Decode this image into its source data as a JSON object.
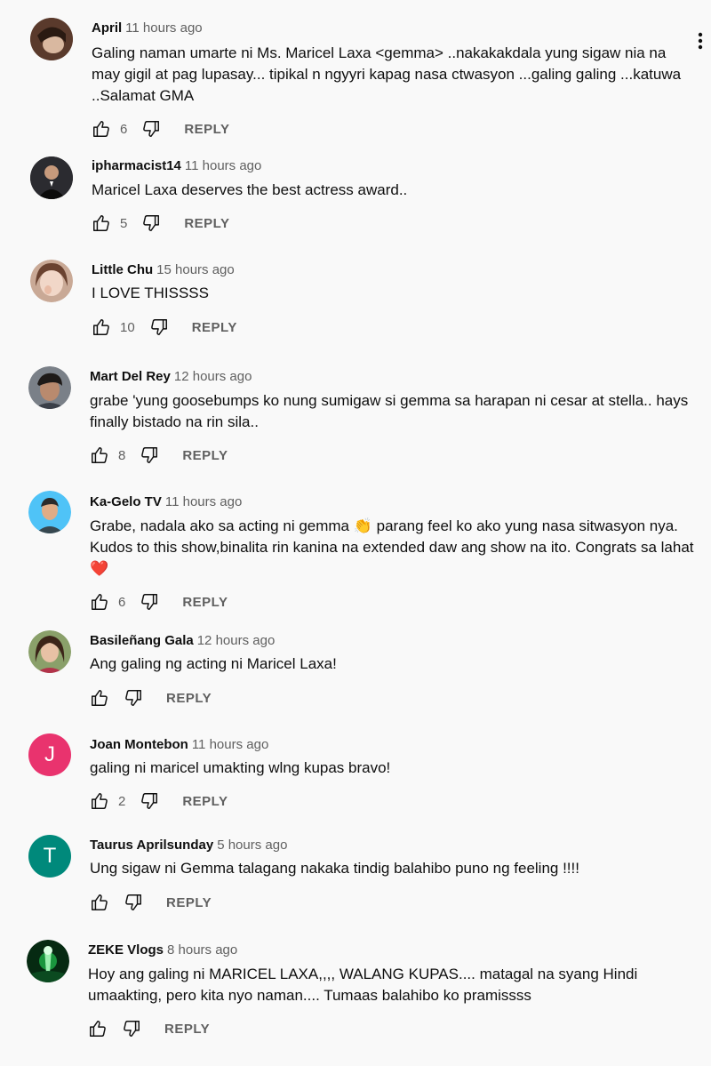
{
  "reply_label": "REPLY",
  "comments": [
    {
      "author": "April",
      "time": "11 hours ago",
      "text": "Galing naman umarte ni Ms. Maricel Laxa <gemma> ..nakakakdala yung sigaw nia na may gigil at pag lupasay... tipikal n ngyyri kapag nasa ctwasyon ...galing galing ...katuwa ..Salamat GMA",
      "likes": "6"
    },
    {
      "author": "ipharmacist14",
      "time": "11 hours ago",
      "text": "Maricel Laxa deserves the best actress award..",
      "likes": "5"
    },
    {
      "author": "Little Chu",
      "time": "15 hours ago",
      "text": "I LOVE THISSSS",
      "likes": "10"
    },
    {
      "author": "Mart Del Rey",
      "time": "12 hours ago",
      "text": "grabe 'yung goosebumps ko nung sumigaw si gemma sa harapan ni cesar at stella.. hays finally bistado na rin sila..",
      "likes": "8"
    },
    {
      "author": "Ka-Gelo TV",
      "time": "11 hours ago",
      "text": "Grabe, nadala ako sa acting ni gemma 👏 parang feel ko ako yung nasa sitwasyon nya. Kudos to this show,binalita rin kanina na extended daw ang show na ito. Congrats sa lahat ❤️",
      "likes": "6"
    },
    {
      "author": "Basileñang Gala",
      "time": "12 hours ago",
      "text": "Ang galing ng acting ni Maricel Laxa!",
      "likes": ""
    },
    {
      "author": "Joan Montebon",
      "time": "11 hours ago",
      "text": "galing ni maricel umakting wlng kupas bravo!",
      "likes": "2",
      "initial": "J"
    },
    {
      "author": "Taurus Aprilsunday",
      "time": "5 hours ago",
      "text": "Ung sigaw ni Gemma talagang nakaka tindig balahibo puno ng feeling !!!!",
      "likes": "",
      "initial": "T"
    },
    {
      "author": "ZEKE Vlogs",
      "time": "8 hours ago",
      "text": "Hoy ang galing ni MARICEL LAXA,,,, WALANG KUPAS.... matagal na syang Hindi umaakting,  pero kita nyo naman.... Tumaas balahibo ko pramissss",
      "likes": ""
    }
  ],
  "colors": {
    "avatar_joan": "#e9336e",
    "avatar_taurus": "#00897b",
    "text_secondary": "#606060"
  },
  "icons": {
    "like": "thumb-up-icon",
    "dislike": "thumb-down-icon",
    "menu": "more-vert-icon"
  }
}
